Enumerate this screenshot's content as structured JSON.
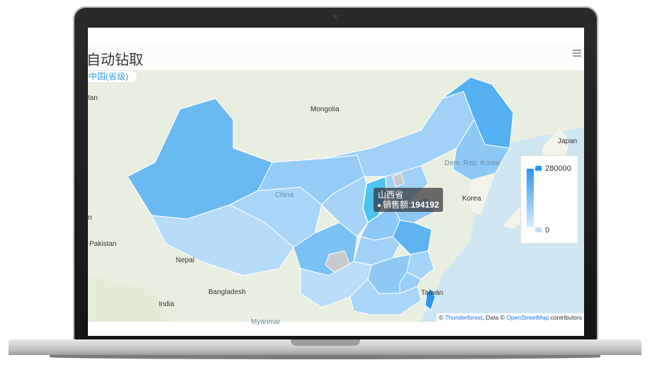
{
  "app": {
    "title": "自动钻取",
    "breadcrumb": "中国(省级)"
  },
  "map": {
    "labels": [
      "Mongolia",
      "Japan",
      "Dem. Rep. Korea",
      "Korea",
      "China",
      "Pakistan",
      "Nepal",
      "Bangladesh",
      "India",
      "Taiwan",
      "tan",
      "n",
      "Myanmar"
    ],
    "attribution": {
      "prefix": "© ",
      "link1": "Thunderforest",
      "mid": ", Data © ",
      "link2": "OpenStreetMap",
      "suffix": " contributors"
    }
  },
  "legend": {
    "max": "280000",
    "min": "0",
    "high_color": "#2b96ee",
    "low_color": "#d4ecff"
  },
  "tooltip": {
    "region": "山西省",
    "metric_label": "销售额",
    "value": "194192"
  },
  "colors": {
    "highlight": "#4fc3f0",
    "no_data": "#c9c9c9"
  }
}
